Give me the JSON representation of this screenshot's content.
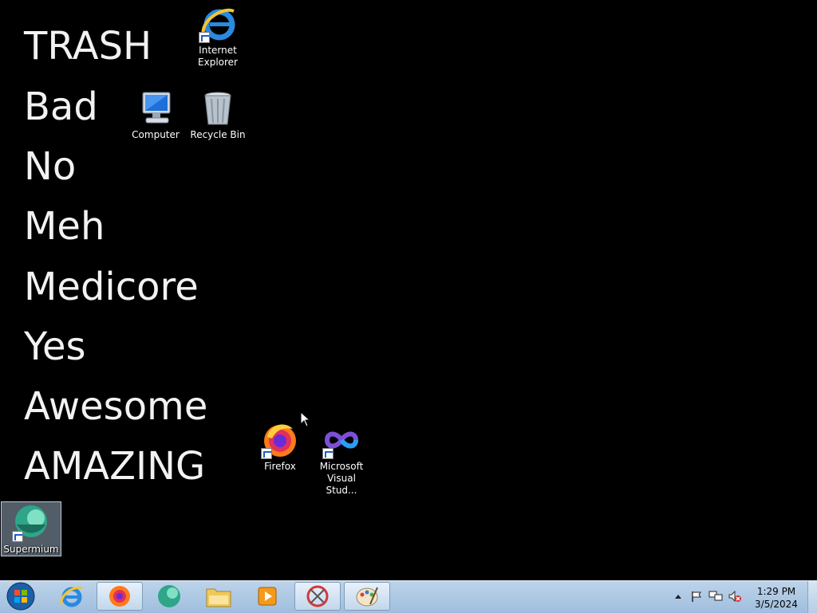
{
  "wallpaper": {
    "words": [
      "TRASH",
      "Bad",
      "No",
      "Meh",
      "Medicore",
      "Yes",
      "Awesome",
      "AMAZING"
    ]
  },
  "desktop_icons": {
    "internet_explorer": "Internet Explorer",
    "computer": "Computer",
    "recycle_bin": "Recycle Bin",
    "firefox": "Firefox",
    "visual_studio": "Microsoft Visual Stud...",
    "supermium": "Supermium"
  },
  "taskbar": {
    "pinned": [
      "start-button",
      "internet-explorer",
      "firefox",
      "supermium",
      "windows-explorer",
      "media-player",
      "snipping-tool",
      "paint"
    ]
  },
  "tray": {
    "time": "1:29 PM",
    "date": "3/5/2024"
  }
}
